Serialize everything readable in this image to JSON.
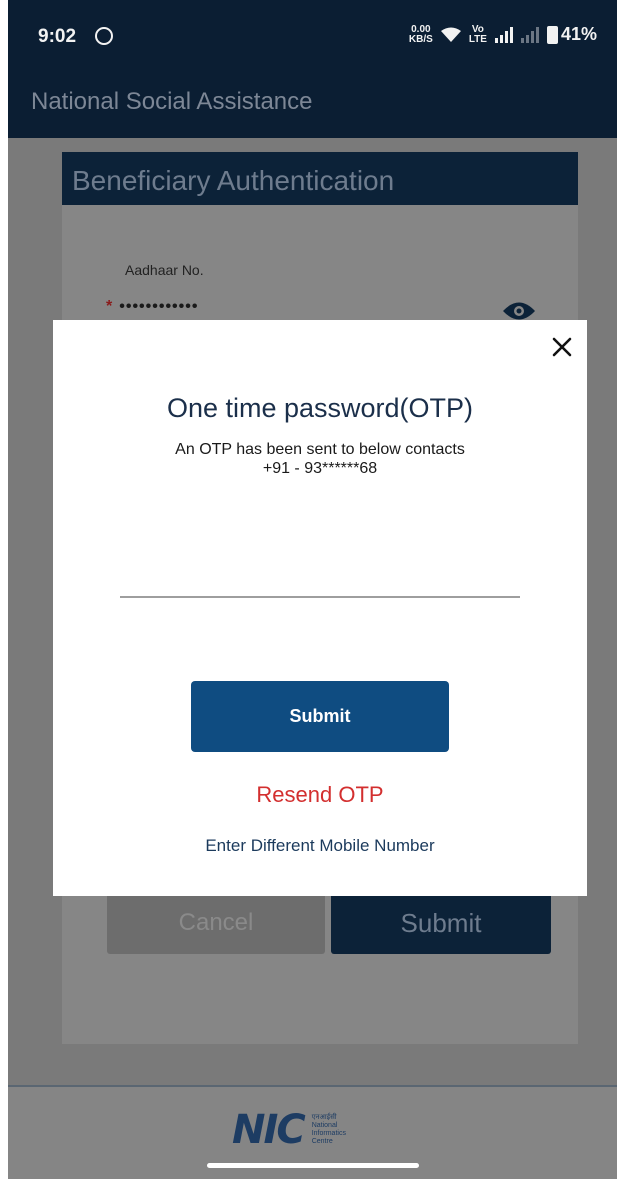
{
  "status_bar": {
    "time": "9:02",
    "speed_top": "0.00",
    "speed_bottom": "KB/S",
    "volte": "Vo",
    "lte": "LTE",
    "battery": "41%"
  },
  "app_bar": {
    "title": "National Social Assistance"
  },
  "form": {
    "section_title": "Beneficiary Authentication",
    "aadhaar_label": "Aadhaar No.",
    "required_marker": "*",
    "aadhaar_value": "••••••••••••",
    "cancel_label": "Cancel",
    "submit_label": "Submit"
  },
  "modal": {
    "title": "One time password(OTP)",
    "message": "An OTP has been sent to below contacts",
    "phone": "+91 - 93******68",
    "otp_value": "",
    "otp_placeholder": "",
    "submit_label": "Submit",
    "resend_label": "Resend OTP",
    "different_label": "Enter Different Mobile Number"
  },
  "footer": {
    "logo_text": "NIC",
    "logo_sub_hindi": "एनआईसी",
    "logo_sub_1": "National",
    "logo_sub_2": "Informatics",
    "logo_sub_3": "Centre"
  },
  "colors": {
    "primary": "#0f4c81",
    "resend": "#d32f2f",
    "header": "#0b1e33"
  }
}
